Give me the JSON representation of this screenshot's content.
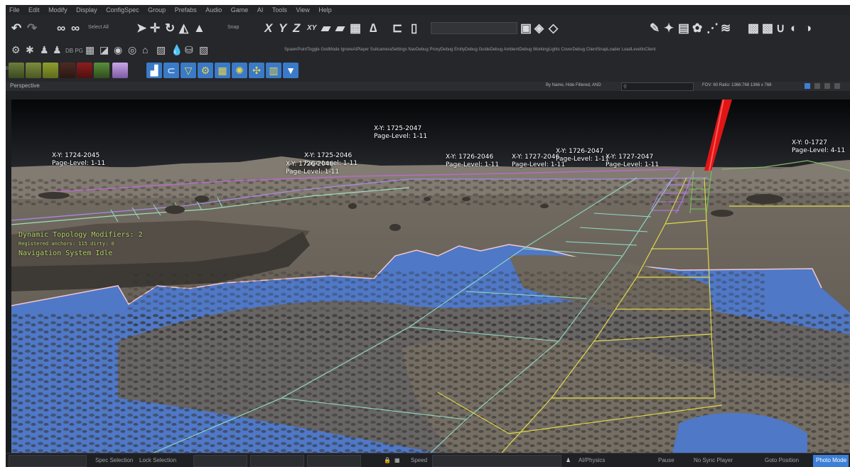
{
  "menu": [
    "File",
    "Edit",
    "Modify",
    "Display",
    "ConfigSpec",
    "Group",
    "Prefabs",
    "Audio",
    "Game",
    "AI",
    "Tools",
    "View",
    "Help"
  ],
  "toolbar": {
    "select_label": "Select All",
    "snap_label": "Snap",
    "axis_x": "X",
    "axis_y": "Y",
    "axis_z": "Z",
    "axis_xy": "XY",
    "tool_dbpg": "DB PG",
    "debug_links": "SpawnPointToggle  GodMode  IgnoreAIPlayer  SuitcameraSettings  NavDebug  ProxyDebug  EntityDebug  GuideDebug  AmbientDebug  WorkingLights  CoverDebug  ClientSnapLoader  LoadLevelInClient"
  },
  "viewport_header": {
    "title": "Perspective",
    "camera_info": "By Name, Hide Filtered, AND",
    "stats": "FOV: 60   Ratio: 1366:768  1366 x 768"
  },
  "overlay": {
    "label_text_prefix_xy": "X-Y:",
    "label_text_prefix_page": "Page-Level:",
    "debug_line1": "Dynamic Topology Modifiers: 2",
    "debug_line2": "Registered anchors: 115 dirty: 0",
    "debug_line3": "Navigation System Idle"
  },
  "tile_labels": [
    {
      "xy": "1724-2045",
      "page": "1-11"
    },
    {
      "xy": "1725-2046",
      "page": "1-11"
    },
    {
      "xy": "1726-2046",
      "page": "1-11"
    },
    {
      "xy": "1725-2047",
      "page": "1-11"
    },
    {
      "xy": "1726-2046",
      "page": "1-11"
    },
    {
      "xy": "1727-2046",
      "page": "1-11"
    },
    {
      "xy": "1726-2047",
      "page": "1-11"
    },
    {
      "xy": "1727-2047",
      "page": "1-11"
    },
    {
      "xy": "0-1727",
      "page": "4-11"
    }
  ],
  "statusbar": {
    "selection": "Spec Selection",
    "lock": "Lock Selection",
    "speed_label": "Speed",
    "ai_physics": "AI/Physics",
    "pause": "Pause",
    "no_sync": "No Sync Player",
    "goto": "Goto Position",
    "mode": "Photo Mode"
  }
}
